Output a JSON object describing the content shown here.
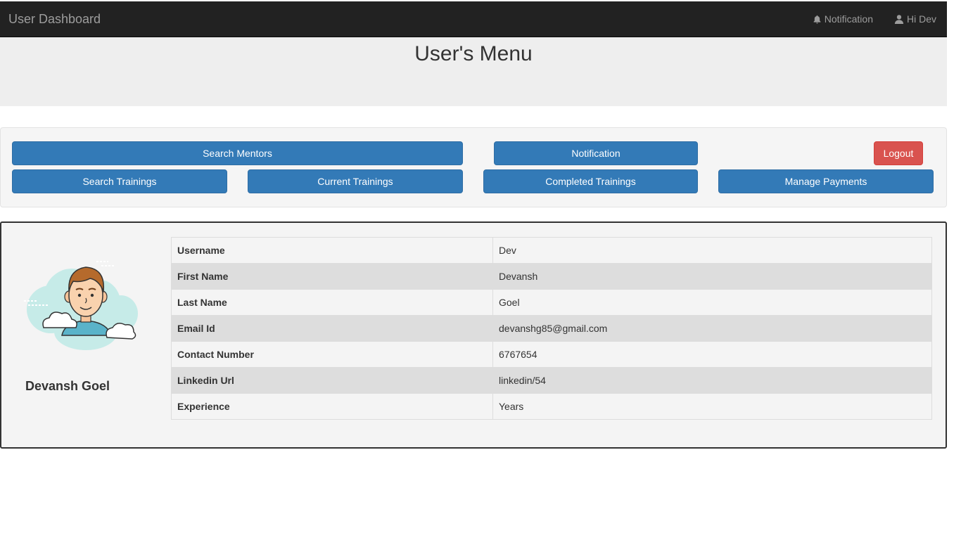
{
  "navbar": {
    "brand": "User Dashboard",
    "notification_label": "Notification",
    "user_label": "Hi Dev"
  },
  "header": {
    "title": "User's Menu"
  },
  "menu": {
    "search_mentors": "Search Mentors",
    "notification": "Notification",
    "logout": "Logout",
    "search_trainings": "Search Trainings",
    "current_trainings": "Current Trainings",
    "completed_trainings": "Completed Trainings",
    "manage_payments": "Manage Payments"
  },
  "profile": {
    "full_name": "Devansh Goel",
    "rows": [
      {
        "label": "Username",
        "value": "Dev"
      },
      {
        "label": "First Name",
        "value": "Devansh"
      },
      {
        "label": "Last Name",
        "value": "Goel"
      },
      {
        "label": "Email Id",
        "value": "devanshg85@gmail.com"
      },
      {
        "label": "Contact Number",
        "value": "6767654"
      },
      {
        "label": "Linkedin Url",
        "value": "linkedin/54"
      },
      {
        "label": "Experience",
        "value": "Years"
      }
    ]
  },
  "colors": {
    "navbar_bg": "#222222",
    "primary": "#337ab7",
    "danger": "#d9534f",
    "jumbotron_bg": "#eeeeee"
  },
  "icons": {
    "notification": "bell-icon",
    "user": "user-icon"
  }
}
